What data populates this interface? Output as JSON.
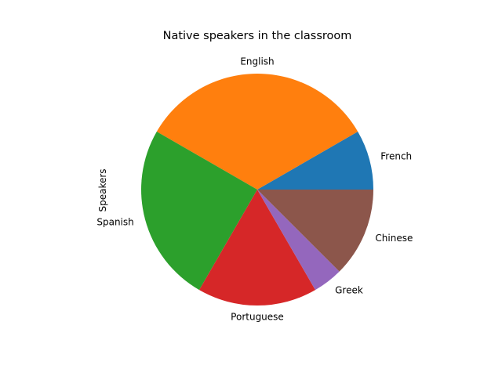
{
  "chart_data": {
    "type": "pie",
    "title": "Native speakers in the classroom",
    "ylabel": "Speakers",
    "categories": [
      "French",
      "English",
      "Spanish",
      "Portuguese",
      "Greek",
      "Chinese"
    ],
    "values": [
      2,
      8,
      6,
      4,
      1,
      3
    ],
    "colors": [
      "#1f77b4",
      "#ff7f0e",
      "#2ca02c",
      "#d62728",
      "#9467bd",
      "#8c564b"
    ],
    "start_angle_deg": 0,
    "direction": "counterclockwise"
  }
}
